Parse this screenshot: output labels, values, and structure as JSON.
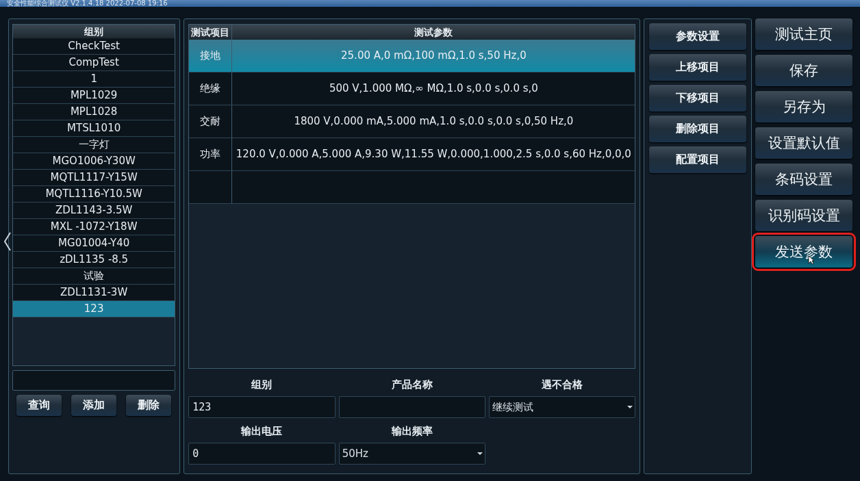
{
  "window": {
    "title": "安全性能综合测试仪 V2.1.4.18 2022-07-08 19:16"
  },
  "groups": {
    "header": "组别",
    "items": [
      {
        "label": "CheckTest",
        "selected": false
      },
      {
        "label": "CompTest",
        "selected": false
      },
      {
        "label": "1",
        "selected": false
      },
      {
        "label": "MPL1029",
        "selected": false
      },
      {
        "label": "MPL1028",
        "selected": false
      },
      {
        "label": "MTSL1010",
        "selected": false
      },
      {
        "label": "一字灯",
        "selected": false
      },
      {
        "label": "MGO1006-Y30W",
        "selected": false
      },
      {
        "label": "MQTL1117-Y15W",
        "selected": false
      },
      {
        "label": "MQTL1116-Y10.5W",
        "selected": false
      },
      {
        "label": "ZDL1143-3.5W",
        "selected": false
      },
      {
        "label": "MXL -1072-Y18W",
        "selected": false
      },
      {
        "label": "MG01004-Y40",
        "selected": false
      },
      {
        "label": "zDL1135 -8.5",
        "selected": false
      },
      {
        "label": "试验",
        "selected": false
      },
      {
        "label": "ZDL1131-3W",
        "selected": false
      },
      {
        "label": "123",
        "selected": true
      }
    ],
    "buttons": [
      "查询",
      "添加",
      "删除"
    ]
  },
  "table": {
    "columns": [
      "测试项目",
      "测试参数"
    ],
    "rows": [
      {
        "item": "接地",
        "params": "25.00 A,0 mΩ,100 mΩ,1.0 s,50 Hz,0",
        "selected": true
      },
      {
        "item": "绝缘",
        "params": "500 V,1.000 MΩ,∞ MΩ,1.0 s,0.0 s,0.0 s,0",
        "selected": false
      },
      {
        "item": "交耐",
        "params": "1800 V,0.000 mA,5.000 mA,1.0 s,0.0 s,0.0 s,0,50 Hz,0",
        "selected": false
      },
      {
        "item": "功率",
        "params": "120.0 V,0.000 A,5.000 A,9.30 W,11.55 W,0.000,1.000,2.5 s,0.0 s,60 Hz,0,0,0",
        "selected": false
      }
    ]
  },
  "form": {
    "fields": [
      {
        "label": "组别",
        "kind": "text",
        "value": "123"
      },
      {
        "label": "产品名称",
        "kind": "text"
      },
      {
        "label": "遇不合格",
        "kind": "select",
        "value": "继续测试"
      },
      {
        "label": "输出电压",
        "kind": "text",
        "value": "0"
      },
      {
        "label": "输出频率",
        "kind": "select",
        "value": "50Hz"
      }
    ]
  },
  "item_buttons": [
    "参数设置",
    "上移项目",
    "下移项目",
    "删除项目",
    "配置项目"
  ],
  "main_buttons": [
    {
      "label": "测试主页",
      "highlighted": false
    },
    {
      "label": "保存",
      "highlighted": false
    },
    {
      "label": "另存为",
      "highlighted": false
    },
    {
      "label": "设置默认值",
      "highlighted": false
    },
    {
      "label": "条码设置",
      "highlighted": false
    },
    {
      "label": "识别码设置",
      "highlighted": false
    },
    {
      "label": "发送参数",
      "highlighted": true
    }
  ]
}
